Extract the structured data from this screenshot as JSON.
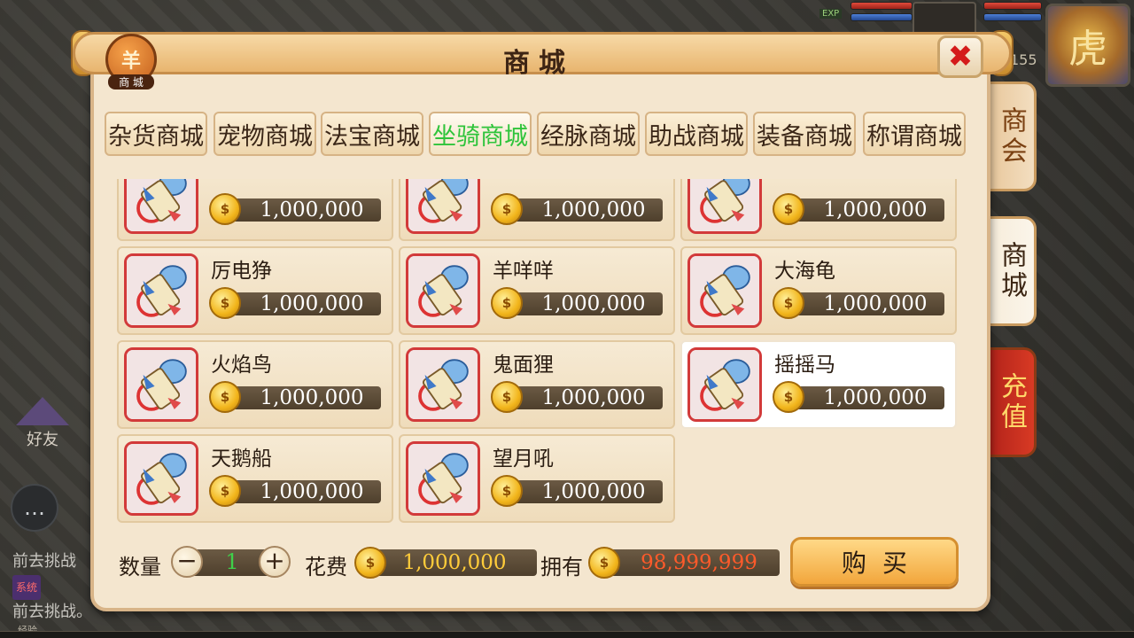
{
  "hud": {
    "exp_tag": "EXP",
    "level": "155",
    "avatar_glyph": "虎"
  },
  "side": {
    "friends_label": "好友",
    "chat_icon": "…",
    "chat_lines": [
      "前去挑战",
      "前去挑战。"
    ],
    "system_tag": "系统",
    "exp_label": "经验"
  },
  "dialog": {
    "title": "商城",
    "icon_glyph": "羊",
    "icon_label": "商 城",
    "close_glyph": "✖"
  },
  "side_tabs": [
    "商会",
    "商城",
    "充值"
  ],
  "category_tabs": [
    {
      "label": "杂货商城",
      "active": false
    },
    {
      "label": "宠物商城",
      "active": false
    },
    {
      "label": "法宝商城",
      "active": false
    },
    {
      "label": "坐骑商城",
      "active": true
    },
    {
      "label": "经脉商城",
      "active": false
    },
    {
      "label": "助战商城",
      "active": false
    },
    {
      "label": "装备商城",
      "active": false
    },
    {
      "label": "称谓商城",
      "active": false
    }
  ],
  "coin_glyph": "$",
  "items": [
    {
      "name": "",
      "price": "1,000,000",
      "selected": false
    },
    {
      "name": "",
      "price": "1,000,000",
      "selected": false
    },
    {
      "name": "",
      "price": "1,000,000",
      "selected": false
    },
    {
      "name": "厉电狰",
      "price": "1,000,000",
      "selected": false
    },
    {
      "name": "羊咩咩",
      "price": "1,000,000",
      "selected": false
    },
    {
      "name": "大海龟",
      "price": "1,000,000",
      "selected": false
    },
    {
      "name": "火焰鸟",
      "price": "1,000,000",
      "selected": false
    },
    {
      "name": "鬼面狸",
      "price": "1,000,000",
      "selected": false
    },
    {
      "name": "摇摇马",
      "price": "1,000,000",
      "selected": true
    },
    {
      "name": "天鹅船",
      "price": "1,000,000",
      "selected": false
    },
    {
      "name": "望月吼",
      "price": "1,000,000",
      "selected": false
    }
  ],
  "purchase": {
    "qty_label": "数量",
    "minus": "−",
    "plus": "+",
    "qty_value": "1",
    "cost_label": "花费",
    "cost_value": "1,000,000",
    "own_label": "拥有",
    "own_value": "98,999,999",
    "buy_label": "购买"
  }
}
